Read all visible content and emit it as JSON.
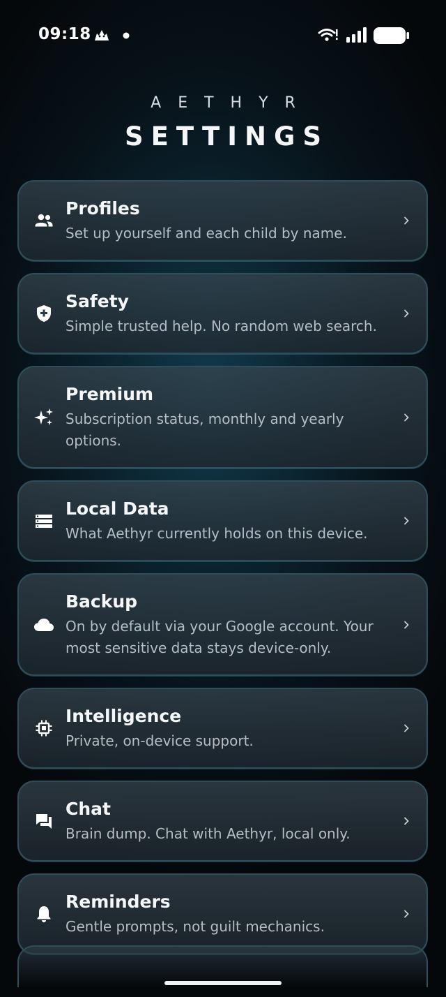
{
  "status_bar": {
    "time": "09:18"
  },
  "header": {
    "brand": "AETHYR",
    "title": "SETTINGS"
  },
  "settings": [
    {
      "title": "Profiles",
      "description": "Set up yourself and each child by name.",
      "icon": "people-icon"
    },
    {
      "title": "Safety",
      "description": "Simple trusted help. No random web search.",
      "icon": "shield-icon"
    },
    {
      "title": "Premium",
      "description": "Subscription status, monthly and yearly options.",
      "icon": "sparkle-icon"
    },
    {
      "title": "Local Data",
      "description": "What Aethyr currently holds on this device.",
      "icon": "storage-icon"
    },
    {
      "title": "Backup",
      "description": "On by default via your Google account. Your most sensitive data stays device-only.",
      "icon": "cloud-icon"
    },
    {
      "title": "Intelligence",
      "description": "Private, on-device support.",
      "icon": "chip-icon"
    },
    {
      "title": "Chat",
      "description": "Brain dump. Chat with Aethyr, local only.",
      "icon": "chat-icon"
    },
    {
      "title": "Reminders",
      "description": "Gentle prompts, not guilt mechanics.",
      "icon": "bell-icon"
    }
  ]
}
